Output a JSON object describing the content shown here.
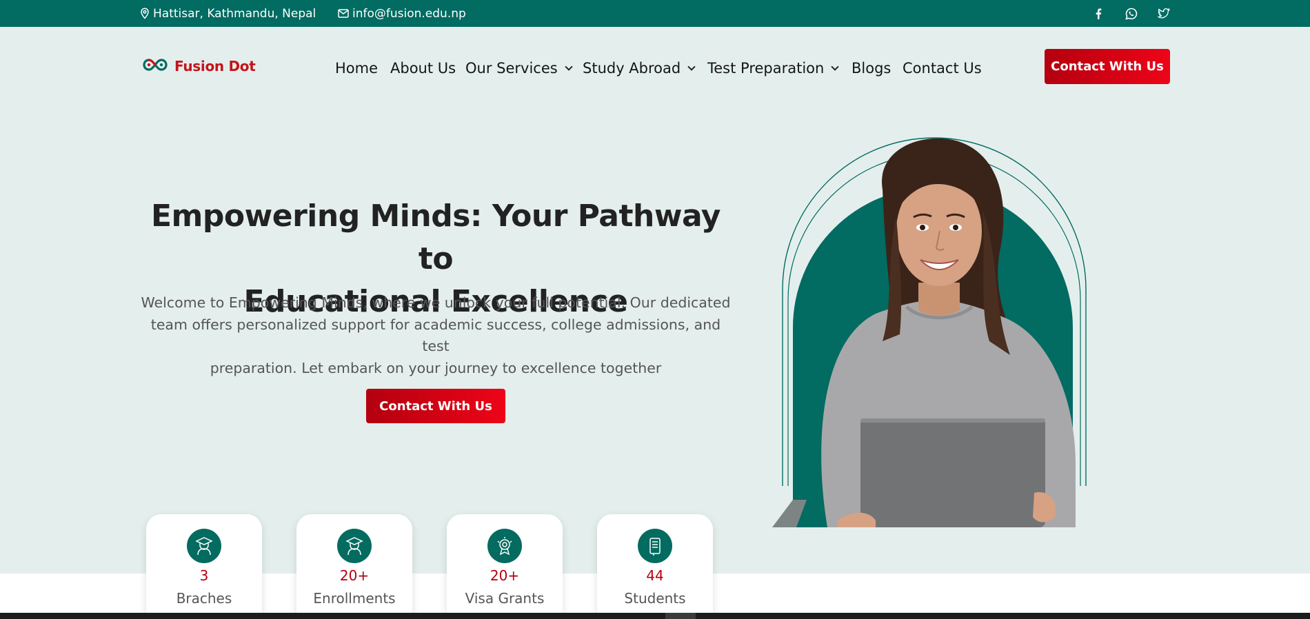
{
  "topbar": {
    "location": "Hattisar, Kathmandu, Nepal",
    "email": "info@fusion.edu.np",
    "social": [
      "facebook-icon",
      "whatsapp-icon",
      "twitter-icon"
    ]
  },
  "brand": {
    "name": "Fusion Dot"
  },
  "nav": {
    "items": [
      {
        "label": "Home",
        "dropdown": false
      },
      {
        "label": "About Us",
        "dropdown": false
      },
      {
        "label": "Our Services",
        "dropdown": true
      },
      {
        "label": "Study Abroad",
        "dropdown": true
      },
      {
        "label": "Test Preparation",
        "dropdown": true
      },
      {
        "label": "Blogs",
        "dropdown": false
      },
      {
        "label": "Contact Us",
        "dropdown": false
      }
    ],
    "cta": "Contact With Us"
  },
  "hero": {
    "title_line1": "Empowering Minds: Your Pathway to",
    "title_line2": "Educational Excellence",
    "desc_line1": "Welcome to Empowering Minds, where we unlock your full potential. Our dedicated",
    "desc_line2": "team offers personalized support for academic success, college admissions, and test",
    "desc_line3": "preparation. Let embark on your journey to excellence together",
    "cta": "Contact With Us"
  },
  "stats": [
    {
      "value": "3",
      "label": "Braches",
      "icon": "graduate-icon"
    },
    {
      "value": "20+",
      "label": "Enrollments",
      "icon": "graduate-icon"
    },
    {
      "value": "20+",
      "label": "Visa Grants",
      "icon": "award-icon"
    },
    {
      "value": "44",
      "label": "Students",
      "icon": "book-icon"
    }
  ],
  "colors": {
    "primary": "#026b62",
    "accent": "#c5141b",
    "background": "#e4efed"
  }
}
